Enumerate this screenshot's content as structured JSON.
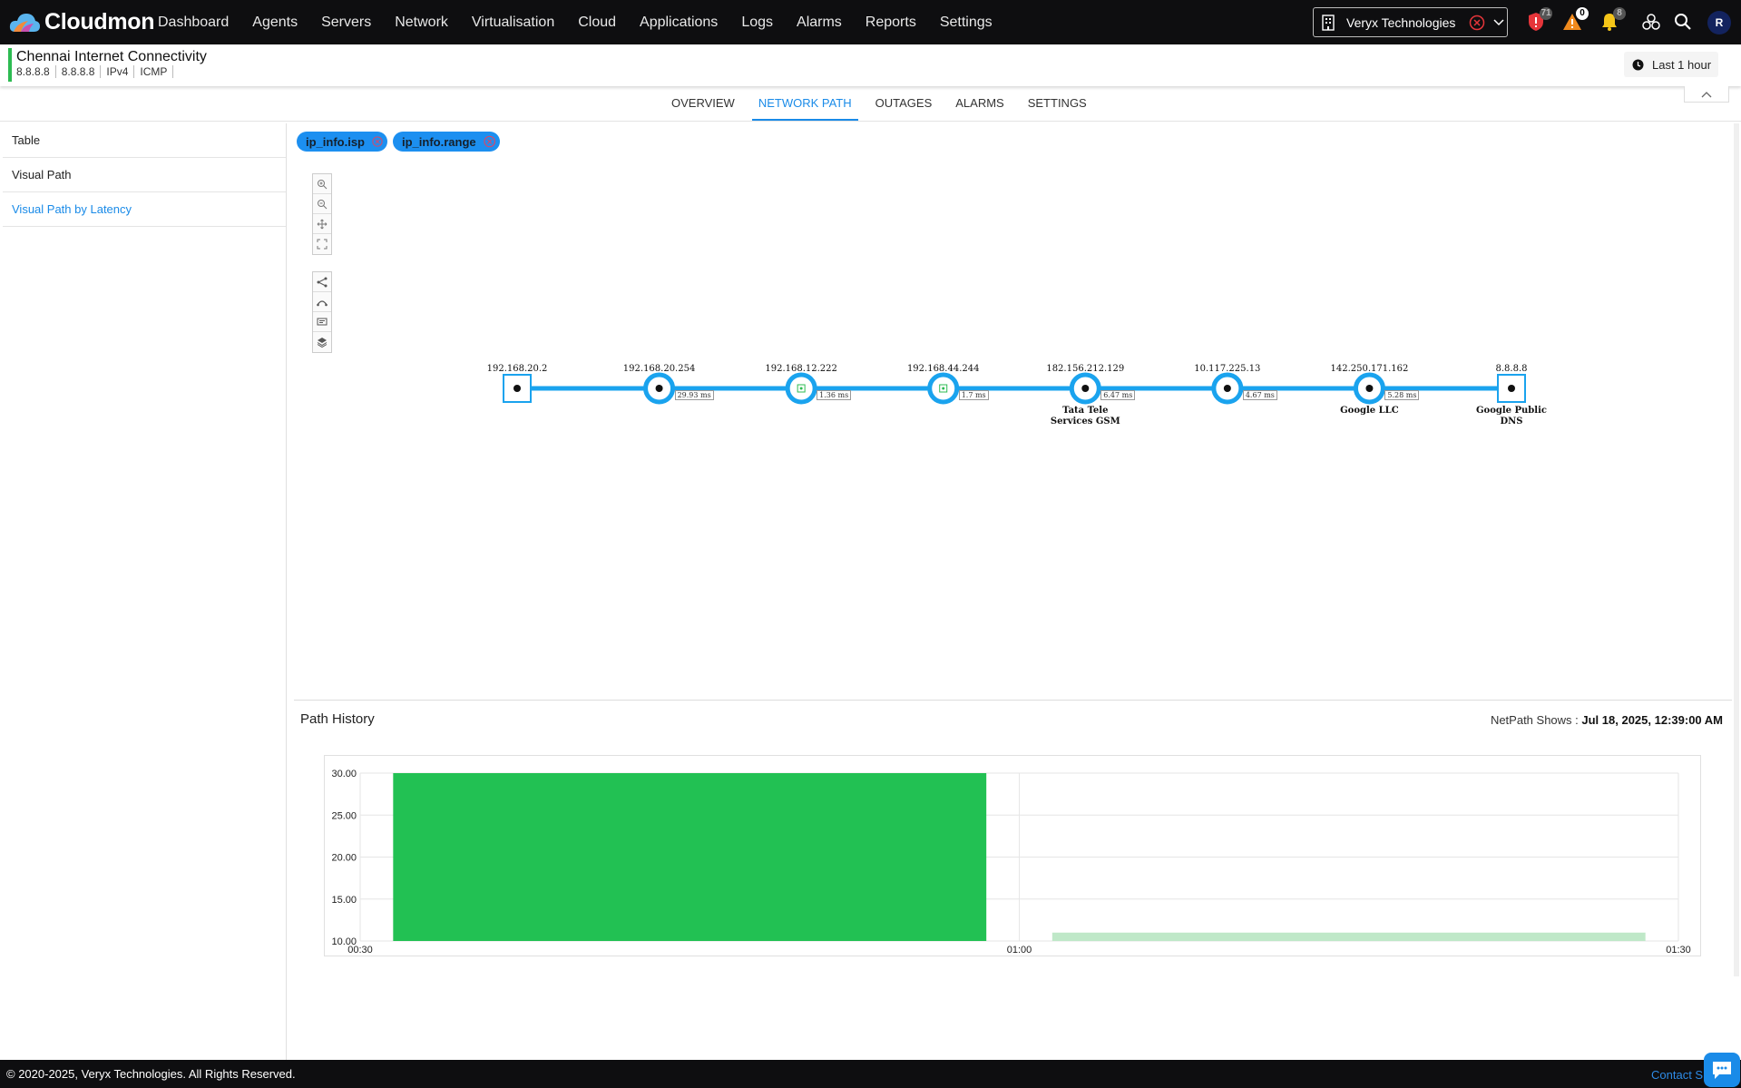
{
  "brand": {
    "name": "Cloudmon"
  },
  "nav": [
    "Dashboard",
    "Agents",
    "Servers",
    "Network",
    "Virtualisation",
    "Cloud",
    "Applications",
    "Logs",
    "Alarms",
    "Reports",
    "Settings"
  ],
  "org_selector": {
    "value": "Veryx Technologies"
  },
  "top_icons": {
    "security_badge": "71",
    "warning_badge": "0",
    "bell_badge": "8"
  },
  "user": {
    "initial": "R"
  },
  "monitor": {
    "title": "Chennai Internet Connectivity",
    "tags": [
      "8.8.8.8",
      "8.8.8.8",
      "IPv4",
      "ICMP"
    ],
    "time_range": "Last 1 hour"
  },
  "tabs": [
    "OVERVIEW",
    "NETWORK PATH",
    "OUTAGES",
    "ALARMS",
    "SETTINGS"
  ],
  "active_tab": "NETWORK PATH",
  "left_menu": [
    "Table",
    "Visual Path",
    "Visual Path by Latency"
  ],
  "active_menu": "Visual Path by Latency",
  "filter_chips": [
    "ip_info.isp",
    "ip_info.range"
  ],
  "path": {
    "nodes": [
      {
        "ip": "192.168.20.2",
        "org": "",
        "shape": "square"
      },
      {
        "ip": "192.168.20.254",
        "org": "",
        "shape": "circle"
      },
      {
        "ip": "192.168.12.222",
        "org": "",
        "shape": "circle-gateway"
      },
      {
        "ip": "192.168.44.244",
        "org": "",
        "shape": "circle-gateway"
      },
      {
        "ip": "182.156.212.129",
        "org": "Tata Tele Services GSM",
        "shape": "circle"
      },
      {
        "ip": "10.117.225.13",
        "org": "",
        "shape": "circle"
      },
      {
        "ip": "142.250.171.162",
        "org": "Google LLC",
        "shape": "circle"
      },
      {
        "ip": "8.8.8.8",
        "org": "Google Public DNS",
        "shape": "square"
      }
    ],
    "latencies": [
      "29.93 ms",
      "1.36 ms",
      "1.7 ms",
      "6.47 ms",
      "4.67 ms",
      "5.28 ms"
    ],
    "link_color": "#1aa3ee"
  },
  "history": {
    "title": "Path History",
    "shows_label": "NetPath Shows :",
    "shows_value": "Jul 18, 2025, 12:39:00 AM"
  },
  "chart_data": {
    "type": "bar",
    "x_ticks": [
      "00:30",
      "01:00",
      "01:30"
    ],
    "y_ticks": [
      "10.00",
      "15.00",
      "20.00",
      "25.00",
      "30.00"
    ],
    "ylim": [
      10,
      30
    ],
    "xlim_minutes": [
      30,
      90
    ],
    "bars": [
      {
        "start_min": 31.5,
        "end_min": 58.5,
        "value": 30,
        "color": "#22c153"
      },
      {
        "start_min": 61.5,
        "end_min": 88.5,
        "value": 11,
        "color": "#bfe8c8"
      }
    ],
    "grid": true
  },
  "footer": {
    "copyright": "© 2020-2025, Veryx Technologies. All Rights Reserved.",
    "contact": "Contact S"
  }
}
